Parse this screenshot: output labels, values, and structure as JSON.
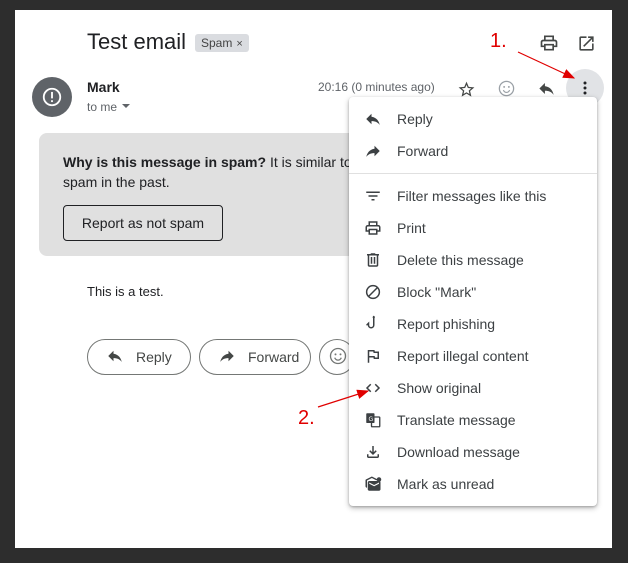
{
  "email": {
    "subject": "Test email",
    "label_badge": "Spam",
    "label_remove": "×",
    "sender_name": "Mark",
    "recipient": "to me",
    "time": "20:16 (0 minutes ago)",
    "body": "This is a test."
  },
  "spam_warning": {
    "title": "Why is this message in spam?",
    "text_line1": "It is similar to",
    "text_line2": "spam in the past.",
    "button_label": "Report as not spam"
  },
  "actions": {
    "reply_label": "Reply",
    "forward_label": "Forward"
  },
  "menu": {
    "items": [
      {
        "label": "Reply",
        "icon": "reply-icon"
      },
      {
        "label": "Forward",
        "icon": "forward-icon"
      },
      {
        "label": "Filter messages like this",
        "icon": "filter-icon"
      },
      {
        "label": "Print",
        "icon": "print-icon"
      },
      {
        "label": "Delete this message",
        "icon": "trash-icon"
      },
      {
        "label": "Block \"Mark\"",
        "icon": "block-icon"
      },
      {
        "label": "Report phishing",
        "icon": "phishing-hook-icon"
      },
      {
        "label": "Report illegal content",
        "icon": "flag-icon"
      },
      {
        "label": "Show original",
        "icon": "code-icon"
      },
      {
        "label": "Translate message",
        "icon": "translate-icon"
      },
      {
        "label": "Download message",
        "icon": "download-icon"
      },
      {
        "label": "Mark as unread",
        "icon": "mark-unread-icon"
      }
    ]
  },
  "annotations": {
    "step1": "1.",
    "step2": "2."
  },
  "colors": {
    "annotation": "#e00000",
    "spam_box": "#e0e0e0",
    "badge": "#dadce0"
  }
}
